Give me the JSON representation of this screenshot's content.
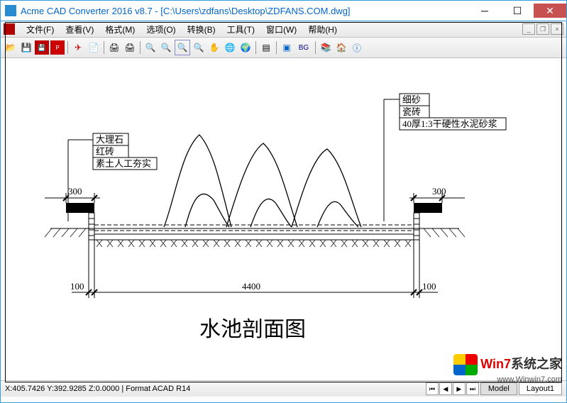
{
  "title": "Acme CAD Converter 2016 v8.7 - [C:\\Users\\zdfans\\Desktop\\ZDFANS.COM.dwg]",
  "menu": [
    "文件(F)",
    "查看(V)",
    "格式(M)",
    "选项(O)",
    "转换(B)",
    "工具(T)",
    "窗口(W)",
    "帮助(H)"
  ],
  "toolbar_icons": [
    "open",
    "save",
    "save-color",
    "pdf",
    "dxf",
    "batch",
    "print",
    "print-preview",
    "zoom-in",
    "zoom-out",
    "zoom-rect",
    "zoom-extents",
    "pan",
    "orbit",
    "globe",
    "layers",
    "layout",
    "bg",
    "layers2",
    "home",
    "info"
  ],
  "drawing": {
    "title_text": "水池剖面图",
    "left_labels": [
      "大理石",
      "红砖",
      "素土人工夯实"
    ],
    "right_labels": [
      "细砂",
      "瓷砖",
      "40厚1:3干硬性水泥砂浆"
    ],
    "dim_300_l": "300",
    "dim_300_r": "300",
    "dim_100_l": "100",
    "dim_100_r": "100",
    "dim_4400": "4400"
  },
  "status": {
    "coords": "X:405.7426 Y:392.9285 Z:0.0000 | Format ACAD R14",
    "tabs": [
      "Model",
      "Layout1"
    ]
  },
  "watermark": {
    "brand1": "Win7",
    "brand2": "系统之家",
    "url": "www.Winwin7.com"
  }
}
